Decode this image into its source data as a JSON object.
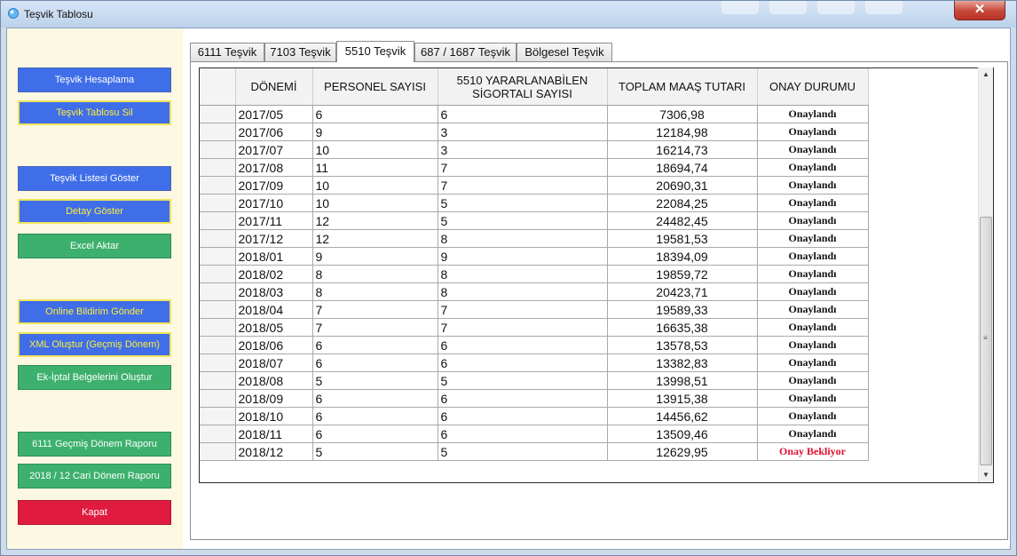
{
  "window": {
    "title": "Teşvik Tablosu",
    "close_glyph": "✕"
  },
  "sidebar": {
    "buttons": [
      {
        "label": "Teşvik Hesaplama"
      },
      {
        "label": "Teşvik Tablosu Sil"
      },
      {
        "label": "Teşvik Listesi Göster"
      },
      {
        "label": "Detay Göster"
      },
      {
        "label": "Excel Aktar"
      },
      {
        "label": "Online Bildirim Gönder"
      },
      {
        "label": "XML Oluştur (Geçmiş Dönem)"
      },
      {
        "label": "Ek-İptal Belgelerini Oluştur"
      },
      {
        "label": "6111 Geçmiş Dönem Raporu"
      },
      {
        "label": "2018 / 12 Cari Dönem Raporu"
      },
      {
        "label": "Kapat"
      }
    ]
  },
  "tabs": [
    {
      "label": "6111 Teşvik"
    },
    {
      "label": "7103 Teşvik"
    },
    {
      "label": "5510 Teşvik",
      "active": true
    },
    {
      "label": "687 / 1687 Teşvik"
    },
    {
      "label": "Bölgesel Teşvik"
    }
  ],
  "grid": {
    "columns": [
      {
        "label": "DÖNEMİ"
      },
      {
        "label": "PERSONEL SAYISI"
      },
      {
        "label": "5510 YARARLANABİLEN SİGORTALI SAYISI"
      },
      {
        "label": "TOPLAM MAAŞ TUTARI"
      },
      {
        "label": "ONAY DURUMU"
      }
    ],
    "rows": [
      {
        "donem": "2017/05",
        "personel": "6",
        "sigortali": "6",
        "maas": "7306,98",
        "onay": "Onaylandı"
      },
      {
        "donem": "2017/06",
        "personel": "9",
        "sigortali": "3",
        "maas": "12184,98",
        "onay": "Onaylandı"
      },
      {
        "donem": "2017/07",
        "personel": "10",
        "sigortali": "3",
        "maas": "16214,73",
        "onay": "Onaylandı"
      },
      {
        "donem": "2017/08",
        "personel": "11",
        "sigortali": "7",
        "maas": "18694,74",
        "onay": "Onaylandı"
      },
      {
        "donem": "2017/09",
        "personel": "10",
        "sigortali": "7",
        "maas": "20690,31",
        "onay": "Onaylandı"
      },
      {
        "donem": "2017/10",
        "personel": "10",
        "sigortali": "5",
        "maas": "22084,25",
        "onay": "Onaylandı"
      },
      {
        "donem": "2017/11",
        "personel": "12",
        "sigortali": "5",
        "maas": "24482,45",
        "onay": "Onaylandı"
      },
      {
        "donem": "2017/12",
        "personel": "12",
        "sigortali": "8",
        "maas": "19581,53",
        "onay": "Onaylandı"
      },
      {
        "donem": "2018/01",
        "personel": "9",
        "sigortali": "9",
        "maas": "18394,09",
        "onay": "Onaylandı"
      },
      {
        "donem": "2018/02",
        "personel": "8",
        "sigortali": "8",
        "maas": "19859,72",
        "onay": "Onaylandı"
      },
      {
        "donem": "2018/03",
        "personel": "8",
        "sigortali": "8",
        "maas": "20423,71",
        "onay": "Onaylandı"
      },
      {
        "donem": "2018/04",
        "personel": "7",
        "sigortali": "7",
        "maas": "19589,33",
        "onay": "Onaylandı"
      },
      {
        "donem": "2018/05",
        "personel": "7",
        "sigortali": "7",
        "maas": "16635,38",
        "onay": "Onaylandı"
      },
      {
        "donem": "2018/06",
        "personel": "6",
        "sigortali": "6",
        "maas": "13578,53",
        "onay": "Onaylandı"
      },
      {
        "donem": "2018/07",
        "personel": "6",
        "sigortali": "6",
        "maas": "13382,83",
        "onay": "Onaylandı"
      },
      {
        "donem": "2018/08",
        "personel": "5",
        "sigortali": "5",
        "maas": "13998,51",
        "onay": "Onaylandı"
      },
      {
        "donem": "2018/09",
        "personel": "6",
        "sigortali": "6",
        "maas": "13915,38",
        "onay": "Onaylandı"
      },
      {
        "donem": "2018/10",
        "personel": "6",
        "sigortali": "6",
        "maas": "14456,62",
        "onay": "Onaylandı"
      },
      {
        "donem": "2018/11",
        "personel": "6",
        "sigortali": "6",
        "maas": "13509,46",
        "onay": "Onaylandı"
      },
      {
        "donem": "2018/12",
        "personel": "5",
        "sigortali": "5",
        "maas": "12629,95",
        "onay": "Onay Bekliyor"
      }
    ]
  },
  "colors": {
    "approved": "#111111",
    "pending": "#e0102f",
    "button_blue": "#3f6ee8",
    "button_green": "#3db06d",
    "button_red": "#e01b40"
  }
}
